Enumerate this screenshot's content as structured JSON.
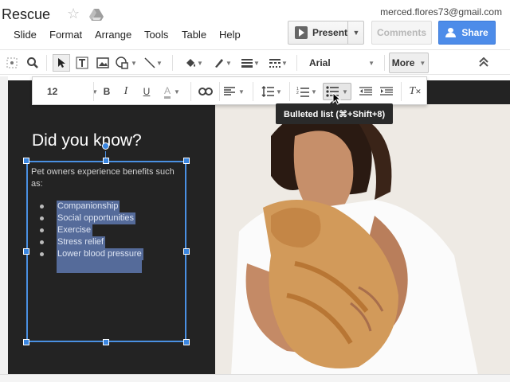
{
  "title_bar": {
    "doc_title": "Rescue",
    "star_icon": "star-icon",
    "drive_icon": "drive-icon",
    "account_email": "merced.flores73@gmail.com"
  },
  "menu": {
    "items": [
      "Slide",
      "Format",
      "Arrange",
      "Tools",
      "Table",
      "Help"
    ]
  },
  "buttons": {
    "present": "Present",
    "comments": "Comments",
    "share": "Share"
  },
  "toolbar": {
    "font": "Arial",
    "more": "More"
  },
  "more_toolbar": {
    "font_size": "12",
    "bold": "B",
    "italic": "I",
    "underline": "U",
    "text_color": "A",
    "clear_format": "T"
  },
  "tooltip": {
    "text": "Bulleted list (⌘+Shift+8)"
  },
  "slide": {
    "heading": "Did you know?",
    "intro": "Pet owners experience benefits such as:",
    "bullets": [
      "Companionship",
      "Social opportunities",
      "Exercise",
      "Stress relief",
      "Lower blood pressure"
    ]
  },
  "colors": {
    "share_blue": "#4d8ce9",
    "selection_blue": "#4a90e2",
    "slide_background": "#232323",
    "text_highlight": "#556b9a"
  }
}
